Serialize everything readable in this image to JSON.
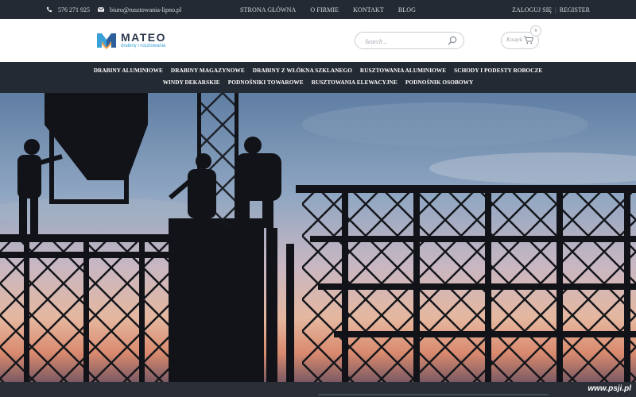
{
  "topbar": {
    "phone": "576 271 925",
    "email": "biuro@rusztowania-lipno.pl",
    "nav": [
      "STRONA GŁÓWNA",
      "O FIRMIE",
      "KONTAKT",
      "BLOG"
    ],
    "login": "ZALOGUJ SIĘ",
    "register": "REGISTER"
  },
  "header": {
    "logo_name": "MATEO",
    "logo_tagline": "drabiny i rusztowania",
    "search_placeholder": "Search...",
    "cart_label": "Koszyk",
    "cart_count": "0"
  },
  "mainnav": {
    "row1": [
      "DRABINY ALUMINIOWE",
      "DRABINY MAGAZYNOWE",
      "DRABINY Z WŁÓKNA SZKLANEGO",
      "RUSZTOWANIA ALUMINIOWE",
      "SCHODY I PODESTY ROBOCZE"
    ],
    "row2": [
      "WINDY DEKARSKIE",
      "PODNOŚNIKI TOWAROWE",
      "RUSZTOWANIA ELEWACYJNE",
      "PODNOŚNIK OSOBOWY"
    ]
  },
  "watermark": "www.psji.pl",
  "colors": {
    "dark_bar": "#242a33",
    "logo_blue": "#3aa0d8",
    "logo_orange": "#f39a3a",
    "logo_navy": "#2d3a4f"
  }
}
